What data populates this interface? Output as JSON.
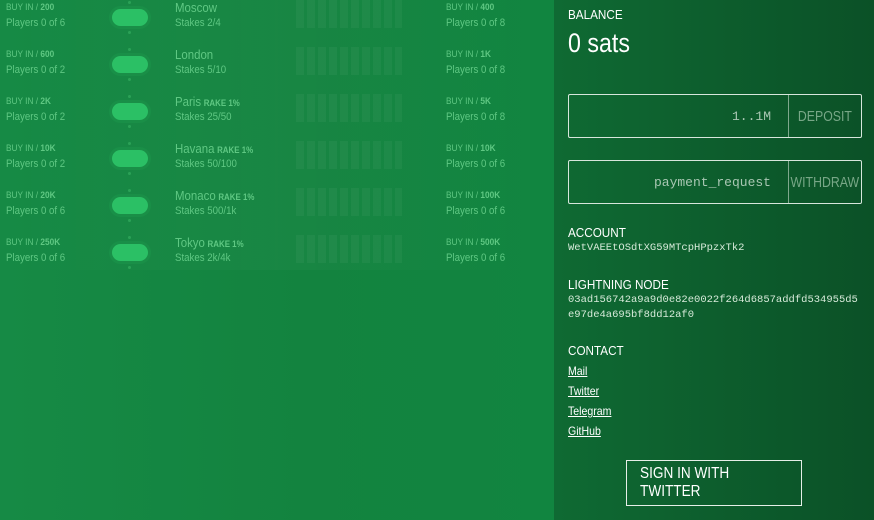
{
  "lobby": {
    "rows": [
      {
        "buyin_prefix": "BUY IN /",
        "buyin": "200",
        "players": "Players 0 of 6",
        "city": "Moscow",
        "rake": "",
        "stakes": "Stakes 2/4",
        "buyin2": "400",
        "players2": "Players 0 of 8"
      },
      {
        "buyin_prefix": "BUY IN /",
        "buyin": "600",
        "players": "Players 0 of 2",
        "city": "London",
        "rake": "",
        "stakes": "Stakes 5/10",
        "buyin2": "1K",
        "players2": "Players 0 of 8"
      },
      {
        "buyin_prefix": "BUY IN /",
        "buyin": "2K",
        "players": "Players 0 of 2",
        "city": "Paris",
        "rake": "RAKE 1%",
        "stakes": "Stakes 25/50",
        "buyin2": "5K",
        "players2": "Players 0 of 8"
      },
      {
        "buyin_prefix": "BUY IN /",
        "buyin": "10K",
        "players": "Players 0 of 2",
        "city": "Havana",
        "rake": "RAKE 1%",
        "stakes": "Stakes 50/100",
        "buyin2": "10K",
        "players2": "Players 0 of 6"
      },
      {
        "buyin_prefix": "BUY IN /",
        "buyin": "20K",
        "players": "Players 0 of 6",
        "city": "Monaco",
        "rake": "RAKE 1%",
        "stakes": "Stakes 500/1k",
        "buyin2": "100K",
        "players2": "Players 0 of 6"
      },
      {
        "buyin_prefix": "BUY IN /",
        "buyin": "250K",
        "players": "Players 0 of 6",
        "city": "Tokyo",
        "rake": "RAKE 1%",
        "stakes": "Stakes 2k/4k",
        "buyin2": "500K",
        "players2": "Players 0 of 6"
      }
    ]
  },
  "panel": {
    "balance_label": "BALANCE",
    "balance_value": "0 sats",
    "deposit": {
      "placeholder": "1..1M",
      "button": "DEPOSIT"
    },
    "withdraw": {
      "placeholder": "payment_request",
      "button": "WITHDRAW"
    },
    "account_label": "ACCOUNT",
    "account_value": "WetVAEEtOSdtXG59MTcpHPpzxTk2",
    "node_label": "LIGHTNING NODE",
    "node_value": "03ad156742a9a9d0e82e0022f264d6857addfd534955d5e97de4a695bf8dd12af0",
    "contact_label": "CONTACT",
    "contact_links": [
      "Mail",
      "Twitter",
      "Telegram",
      "GitHub"
    ],
    "signin_button": "SIGN IN WITH TWITTER"
  },
  "colors": {
    "lobby_bg": "#148843",
    "panel_bg": "#0b5127",
    "muted_text": "#5fc883",
    "table_icon": "#2bc065"
  }
}
